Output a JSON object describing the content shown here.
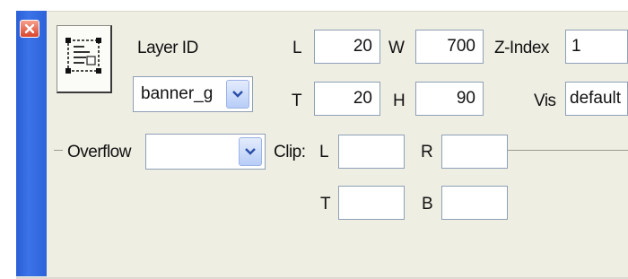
{
  "panel": {
    "close_icon": "close-icon",
    "layer_icon": "layer-properties-icon"
  },
  "layer": {
    "id_label": "Layer ID",
    "id_value": "banner_g",
    "left_label": "L",
    "left_value": "20",
    "top_label": "T",
    "top_value": "20",
    "width_label": "W",
    "width_value": "700",
    "height_label": "H",
    "height_value": "90",
    "zindex_label": "Z-Index",
    "zindex_value": "1",
    "vis_label": "Vis",
    "vis_value": "default"
  },
  "overflow": {
    "label": "Overflow",
    "value": ""
  },
  "clip": {
    "label": "Clip:",
    "left_label": "L",
    "left_value": "",
    "right_label": "R",
    "right_value": "",
    "top_label": "T",
    "top_value": "",
    "bottom_label": "B",
    "bottom_value": ""
  },
  "colors": {
    "panel_bg": "#efeee3",
    "side_strip": "#2d63da",
    "field_border": "#8ea0b6"
  }
}
